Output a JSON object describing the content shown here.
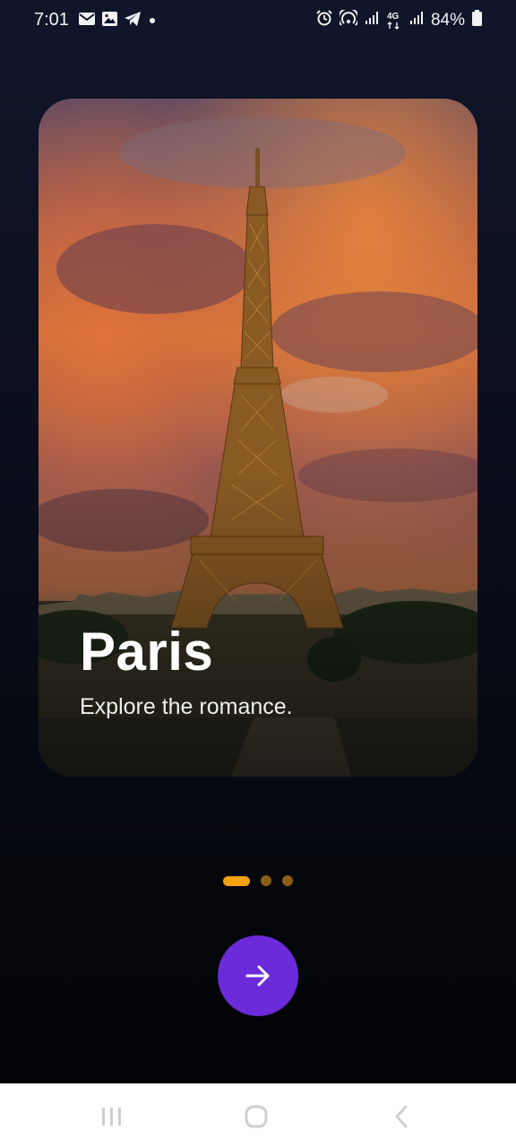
{
  "status_bar": {
    "time": "7:01",
    "left_icons": [
      "mail-icon",
      "gallery-icon",
      "telegram-icon",
      "dot-icon"
    ],
    "right_icons": [
      "alarm-icon",
      "hotspot-icon",
      "signal-icon",
      "4g-icon",
      "signal-icon"
    ],
    "network_label": "4G",
    "battery": "84%"
  },
  "card": {
    "title": "Paris",
    "subtitle": "Explore the romance.",
    "image": "eiffel-tower-sunset-photo"
  },
  "pager": {
    "total": 3,
    "active": 0,
    "active_color": "#f4a111",
    "inactive_color": "#8a5e16"
  },
  "next_button": {
    "icon": "arrow-right-icon",
    "color": "#6b2bd8"
  },
  "nav_bar": {
    "buttons": [
      "recents-button",
      "home-button",
      "back-button"
    ]
  }
}
